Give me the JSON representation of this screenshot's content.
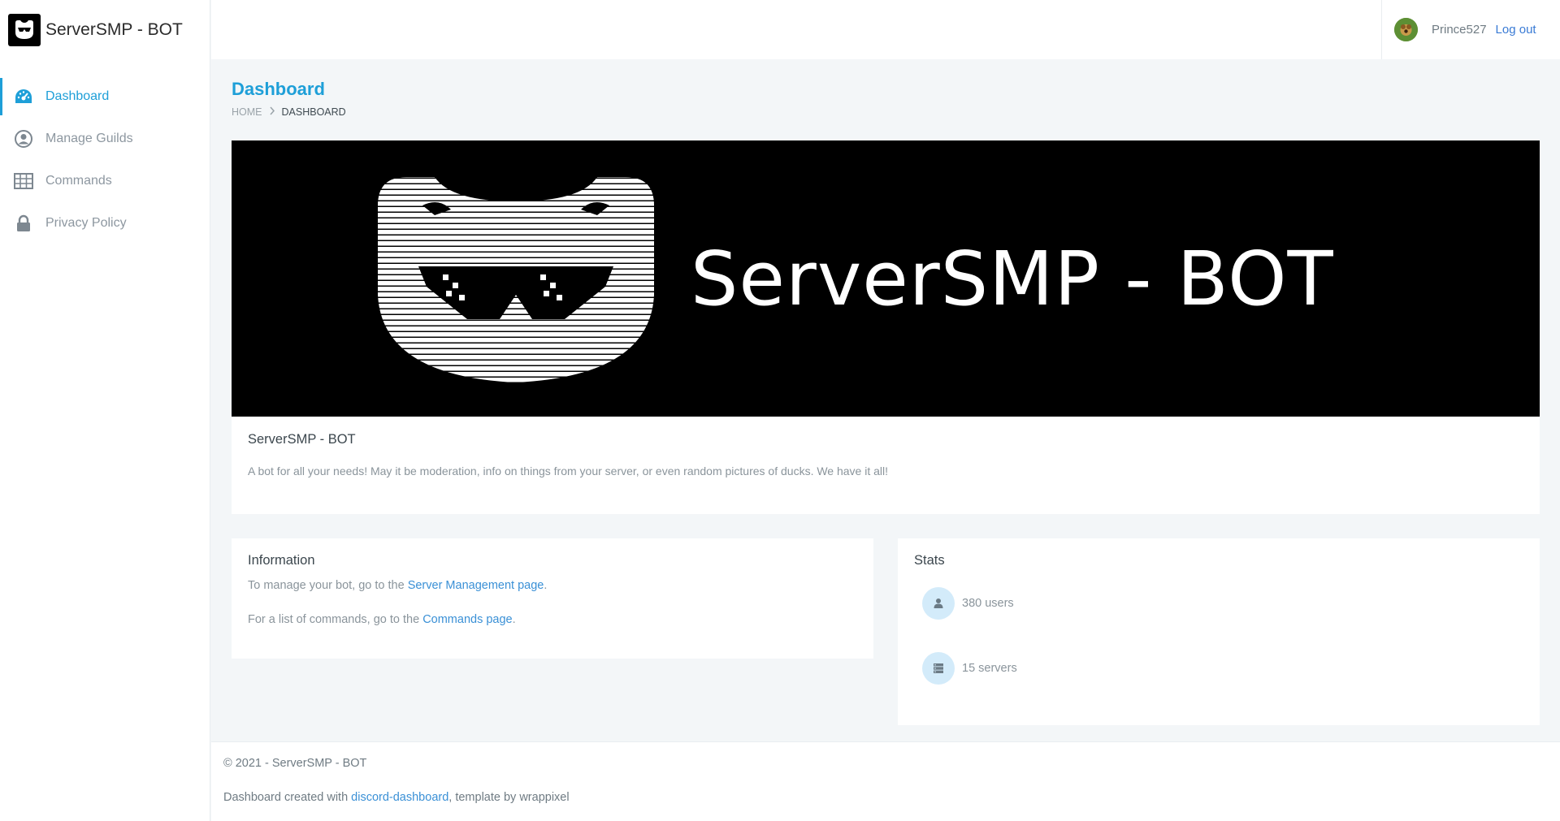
{
  "app": {
    "name": "ServerSMP - BOT"
  },
  "sidebar": {
    "items": [
      {
        "label": "Dashboard",
        "icon": "dashboard-gauge-icon",
        "active": true
      },
      {
        "label": "Manage Guilds",
        "icon": "user-circle-icon",
        "active": false
      },
      {
        "label": "Commands",
        "icon": "table-icon",
        "active": false
      },
      {
        "label": "Privacy Policy",
        "icon": "lock-icon",
        "active": false
      }
    ]
  },
  "topbar": {
    "username": "Prince527",
    "logout_label": "Log out"
  },
  "page": {
    "title": "Dashboard",
    "breadcrumb": {
      "home": "HOME",
      "current": "DASHBOARD"
    }
  },
  "banner": {
    "text": "ServerSMP - BOT",
    "card_title": "ServerSMP - BOT",
    "description": "A bot for all your needs! May it be moderation, info on things from your server, or even random pictures of ducks. We have it all!"
  },
  "information": {
    "title": "Information",
    "line1_prefix": "To manage your bot, go to the ",
    "line1_link": "Server Management page",
    "line1_suffix": ".",
    "line2_prefix": "For a list of commands, go to the ",
    "line2_link": "Commands page",
    "line2_suffix": "."
  },
  "stats": {
    "title": "Stats",
    "users": "380 users",
    "servers": "15 servers"
  },
  "footer": {
    "copyright": "© 2021 - ServerSMP - BOT",
    "credit_prefix": "Dashboard created with ",
    "credit_link": "discord-dashboard",
    "credit_suffix": ", template by wrappixel"
  },
  "colors": {
    "accent": "#1e9fd8",
    "link": "#3a90d6",
    "background": "#f3f6f8",
    "banner": "#000000"
  }
}
